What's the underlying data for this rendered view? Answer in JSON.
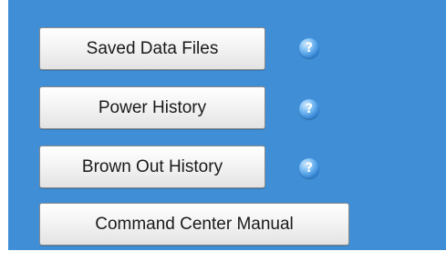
{
  "panel": {
    "background_color": "#3f8ed6"
  },
  "buttons": [
    {
      "label": "Saved Data Files",
      "has_help": true,
      "help_icon": "question-icon"
    },
    {
      "label": "Power History",
      "has_help": true,
      "help_icon": "question-icon"
    },
    {
      "label": "Brown Out History",
      "has_help": true,
      "help_icon": "question-icon"
    },
    {
      "label": "Command Center Manual",
      "has_help": false
    }
  ],
  "help_glyph": "?"
}
